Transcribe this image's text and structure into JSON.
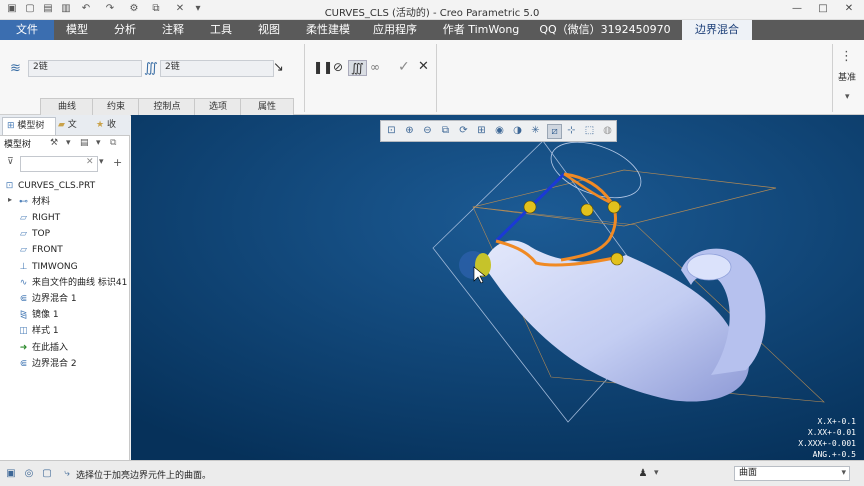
{
  "window": {
    "title": "CURVES_CLS (活动的) - Creo Parametric 5.0",
    "min_label": "—",
    "max_label": "□",
    "close_label": "✕"
  },
  "menubar": {
    "items": [
      "文件",
      "模型",
      "分析",
      "注释",
      "工具",
      "视图",
      "柔性建模",
      "应用程序",
      "作者 TimWong",
      "QQ（微信）3192450970",
      "边界混合"
    ]
  },
  "ribbon": {
    "first_direction_field": "2链",
    "second_direction_field": "2链",
    "tabs": [
      "曲线",
      "约束",
      "控制点",
      "选项",
      "属性"
    ],
    "base_label": "基准"
  },
  "left_panel": {
    "tabs": [
      "模型树",
      "文",
      "收"
    ],
    "tree_label": "模型树",
    "root": "CURVES_CLS.PRT",
    "items": [
      {
        "label": "材料",
        "icon": "material-icon"
      },
      {
        "label": "RIGHT",
        "icon": "datum-plane-icon"
      },
      {
        "label": "TOP",
        "icon": "datum-plane-icon"
      },
      {
        "label": "FRONT",
        "icon": "datum-plane-icon"
      },
      {
        "label": "TIMWONG",
        "icon": "coordinate-system-icon"
      },
      {
        "label": "来自文件的曲线 标识41",
        "icon": "curve-icon"
      },
      {
        "label": "边界混合 1",
        "icon": "boundary-blend-icon"
      },
      {
        "label": "镜像 1",
        "icon": "mirror-icon"
      },
      {
        "label": "样式 1",
        "icon": "style-icon"
      },
      {
        "label": "在此插入",
        "icon": "insert-here-arrow-icon"
      },
      {
        "label": "边界混合 2",
        "icon": "boundary-blend-icon"
      }
    ]
  },
  "viewport": {
    "tolerances": [
      "X.X+-0.1",
      "X.XX+-0.01",
      "X.XXX+-0.001",
      "ANG.+-0.5"
    ],
    "background": "#0b3f70",
    "surface_color": "#c9d3f5"
  },
  "statusbar": {
    "message": "选择位于加亮边界元件上的曲面。",
    "filter_value": "曲面"
  }
}
